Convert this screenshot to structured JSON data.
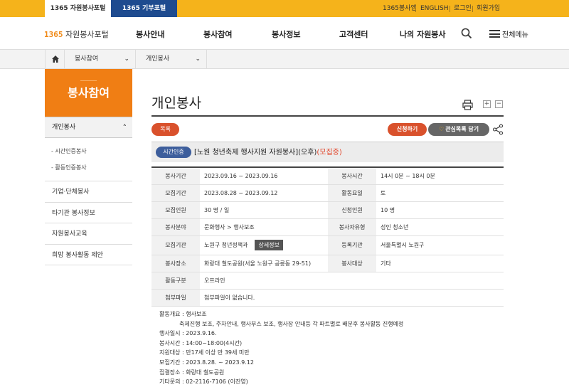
{
  "top_tabs": [
    "1365 자원봉사포털",
    "1365 기부포털"
  ],
  "util_links": [
    "1365봉사앱",
    "ENGLISH",
    "로그인",
    "회원가입"
  ],
  "logo": {
    "num": "1365",
    "text": "자원봉사포털"
  },
  "menu": [
    "봉사안내",
    "봉사참여",
    "봉사정보",
    "고객센터",
    "나의 자원봉사"
  ],
  "all_menu": "전체메뉴",
  "location": [
    "봉사참여",
    "개인봉사"
  ],
  "sidebar": {
    "title": "봉사참여",
    "active": "개인봉사",
    "sub": [
      "- 시간인증봉사",
      "- 활동인증봉사"
    ],
    "items": [
      "기업·단체봉사",
      "타기관 봉사정보",
      "자원봉사교육",
      "희망 봉사활동 제안"
    ]
  },
  "page_title": "개인봉사",
  "buttons": {
    "list": "목록",
    "apply": "신청하기",
    "favorite": "관심목록 담기"
  },
  "item": {
    "badge": "시간인증",
    "title": "[노원 청년축제 행사지원 자원봉사](오후)",
    "status": "(모집중)"
  },
  "info": {
    "rows": [
      [
        "봉사기간",
        "2023.09.16 ~ 2023.09.16",
        "봉사시간",
        "14시 0분 ~ 18시 0분"
      ],
      [
        "모집기간",
        "2023.08.28 ~ 2023.09.12",
        "활동요일",
        "토"
      ],
      [
        "모집인원",
        "30 명 / 일",
        "신청인원",
        "10 명"
      ],
      [
        "봉사분야",
        "문화행사 > 행사보조",
        "봉사자유형",
        "성인 청소년"
      ],
      [
        "모집기관",
        "노원구 청년정책과",
        "등록기관",
        "서울특별시 노원구"
      ],
      [
        "봉사장소",
        "화랑대 철도공원(서울 노원구 공릉동 29-51)",
        "봉사대상",
        "기타"
      ]
    ],
    "detail_tag": "상세정보",
    "activity_type_label": "활동구분",
    "activity_type": "오프라인",
    "attach_label": "첨부파일",
    "attach": "첨부파일이 없습니다."
  },
  "description": [
    "활동개요 : 행사보조",
    "축제진행 보조, 주차안내, 행사부스 보조, 행사장 안내등 각 파트별로 배분후 봉사활동 진행예정",
    "행사일시 : 2023.9.16.",
    "봉사시간 : 14:00~18:00(4시간)",
    "지원대상 : 만17세 이상 만 39세 미만",
    "모집기간 : 2023.8.28. ~ 2023.9.12",
    "집결장소 : 화랑대 철도공원",
    "기타문의 : 02-2116-7106 (이진영)"
  ]
}
